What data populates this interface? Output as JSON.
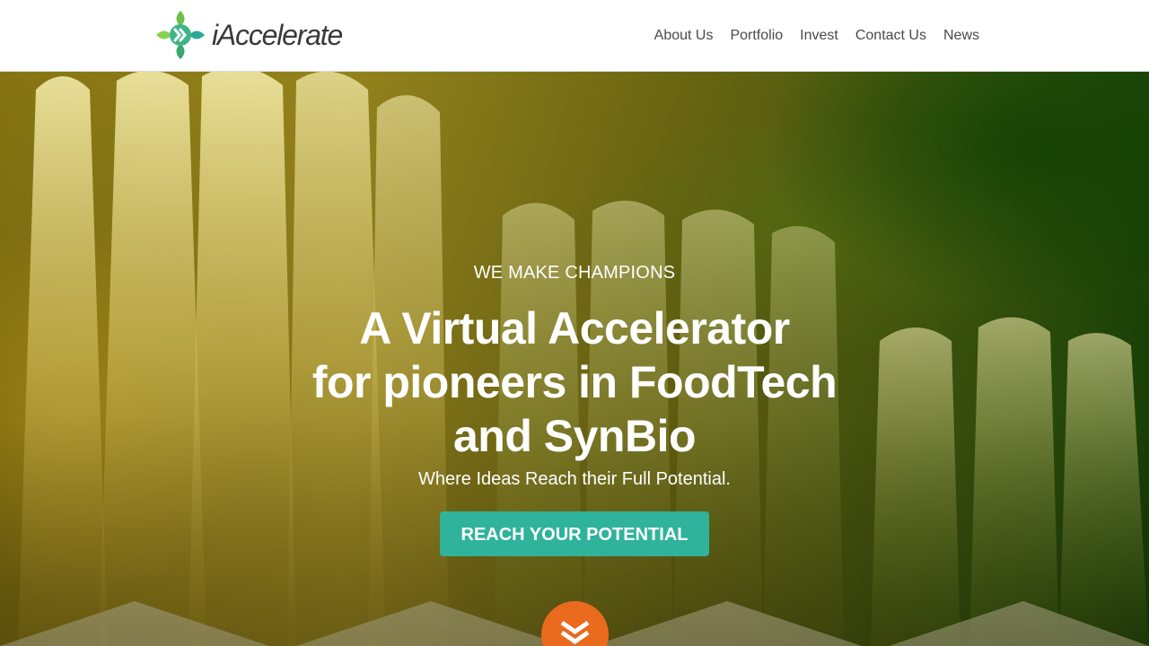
{
  "header": {
    "logo_text": "iAccelerate",
    "nav": [
      {
        "label": "About Us"
      },
      {
        "label": "Portfolio"
      },
      {
        "label": "Invest"
      },
      {
        "label": "Contact Us"
      },
      {
        "label": "News"
      }
    ]
  },
  "hero": {
    "eyebrow": "WE MAKE CHAMPIONS",
    "headline_line1": "A Virtual Accelerator",
    "headline_line2": "for pioneers in FoodTech",
    "headline_line3": "and SynBio",
    "subline": "Where Ideas Reach their Full Potential.",
    "cta_label": "REACH YOUR POTENTIAL",
    "scroll_icon": "double-chevron-down-icon"
  },
  "colors": {
    "accent": "#2fb39b",
    "scroll_button": "#ea6a1e",
    "logo_green": "#6cc04a",
    "logo_teal": "#2fa89a",
    "nav_text": "#4a4a4a"
  }
}
